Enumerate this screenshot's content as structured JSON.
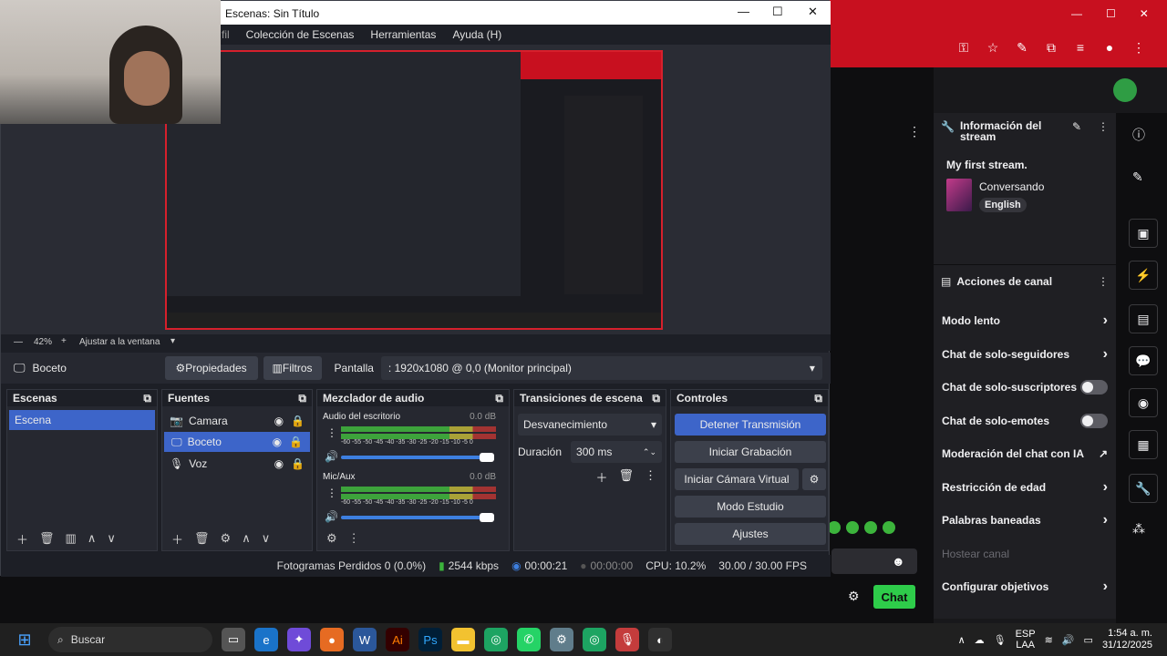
{
  "obs": {
    "window_title": "Escenas: Sin Título",
    "menu": [
      "fil",
      "Colección de Escenas",
      "Herramientas",
      "Ayuda (H)"
    ],
    "zoom": "42%",
    "fit_label": "Ajustar a la ventana",
    "current_source": "Boceto",
    "properties_btn": "Propiedades",
    "filters_btn": "Filtros",
    "display_label": "Pantalla",
    "display_value": ": 1920x1080 @ 0,0 (Monitor principal)",
    "scenes": {
      "title": "Escenas",
      "items": [
        "Escena"
      ]
    },
    "sources": {
      "title": "Fuentes",
      "items": [
        "Camara",
        "Boceto",
        "Voz"
      ]
    },
    "mixer": {
      "title": "Mezclador de audio",
      "channels": [
        {
          "name": "Audio del escritorio",
          "db": "0.0 dB"
        },
        {
          "name": "Mic/Aux",
          "db": "0.0 dB"
        }
      ],
      "scale": "-60 -55 -50 -45 -40 -35 -30 -25 -20 -15 -10 -5 0"
    },
    "transitions": {
      "title": "Transiciones de escena",
      "type": "Desvanecimiento",
      "duration_label": "Duración",
      "duration": "300 ms"
    },
    "controls": {
      "title": "Controles",
      "buttons": [
        "Detener Transmisión",
        "Iniciar Grabación",
        "Iniciar Cámara Virtual",
        "Modo Estudio",
        "Ajustes"
      ]
    },
    "status": {
      "dropped": "Fotogramas Perdidos 0 (0.0%)",
      "bitrate": "2544 kbps",
      "live_time": "00:00:21",
      "rec_time": "00:00:00",
      "cpu": "CPU: 10.2%",
      "fps": "30.00 / 30.00 FPS"
    }
  },
  "twitch": {
    "stream_info_title": "Información del stream",
    "stream_title": "My first stream.",
    "category": "Conversando",
    "tag": "English",
    "actions_title": "Acciones de canal",
    "actions": [
      {
        "label": "Modo lento",
        "kind": "chevron"
      },
      {
        "label": "Chat de solo-seguidores",
        "kind": "chevron"
      },
      {
        "label": "Chat de solo-suscriptores",
        "kind": "toggle"
      },
      {
        "label": "Chat de solo-emotes",
        "kind": "toggle"
      },
      {
        "label": "Moderación del chat con IA",
        "kind": "link"
      },
      {
        "label": "Restricción de edad",
        "kind": "chevron"
      },
      {
        "label": "Palabras baneadas",
        "kind": "chevron"
      },
      {
        "label": "Hostear canal",
        "kind": "disabled"
      },
      {
        "label": "Configurar objetivos",
        "kind": "chevron"
      }
    ],
    "chat_button": "Chat"
  },
  "taskbar": {
    "search": "Buscar",
    "lang": "ESP",
    "lang2": "LAA",
    "time": "1:54 a. m.",
    "date": "31/12/2025"
  }
}
